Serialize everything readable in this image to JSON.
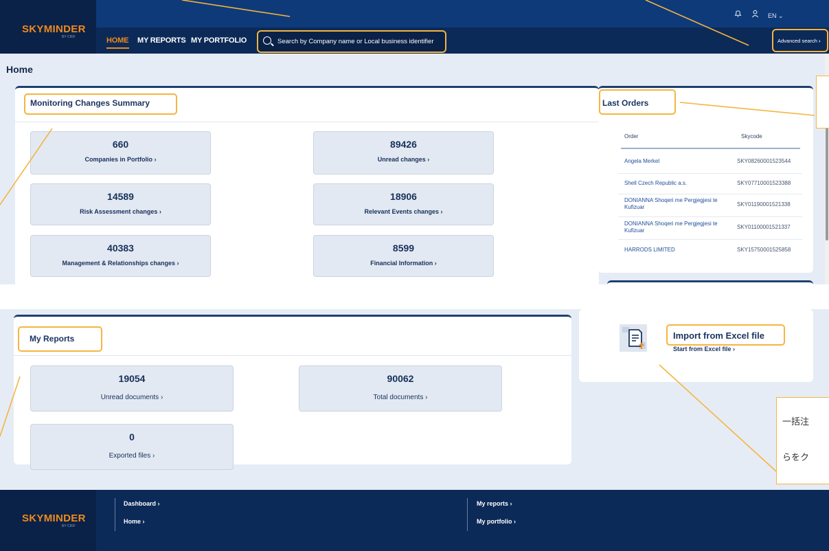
{
  "brand": {
    "name": "SKYMINDER",
    "sub": "BY CRIF"
  },
  "nav": {
    "home": "HOME",
    "reports": "MY REPORTS",
    "portfolio": "MY PORTFOLIO"
  },
  "search": {
    "placeholder": "Search by Company name or Local business identifier"
  },
  "header": {
    "advanced": "Advanced search",
    "lang": "EN"
  },
  "page": {
    "title": "Home"
  },
  "monitoring": {
    "title": "Monitoring Changes Summary",
    "cards": [
      {
        "value": "660",
        "label": "Companies in Portfolio"
      },
      {
        "value": "89426",
        "label": "Unread changes"
      },
      {
        "value": "14589",
        "label": "Risk Assessment changes"
      },
      {
        "value": "18906",
        "label": "Relevant Events changes"
      },
      {
        "value": "40383",
        "label": "Management & Relationships changes"
      },
      {
        "value": "8599",
        "label": "Financial Information"
      }
    ]
  },
  "last_orders": {
    "title": "Last Orders",
    "col_order": "Order",
    "col_skycode": "Skycode",
    "rows": [
      {
        "order": "Angela Merkel",
        "skycode": "SKY08260001523544"
      },
      {
        "order": "Shell Czech Republic a.s.",
        "skycode": "SKY07710001523388"
      },
      {
        "order": "DONIANNA Shoqeri me Pergjegjesi te Kufizuar",
        "skycode": "SKY01190001521338"
      },
      {
        "order": "DONIANNA Shoqeri me Pergjegjesi te Kufizuar",
        "skycode": "SKY01100001521337"
      },
      {
        "order": "HARRODS LIMITED",
        "skycode": "SKY15750001525858"
      }
    ]
  },
  "reports": {
    "title": "My Reports",
    "cards": [
      {
        "value": "19054",
        "label": "Unread documents"
      },
      {
        "value": "90062",
        "label": "Total documents"
      },
      {
        "value": "0",
        "label": "Exported files"
      }
    ]
  },
  "import": {
    "title": "Import from Excel file",
    "link": "Start from Excel file"
  },
  "footer": {
    "dashboard": "Dashboard",
    "home": "Home",
    "my_reports": "My reports",
    "my_portfolio": "My portfolio"
  },
  "callouts": {
    "line1": "一括注",
    "line2": "らをク"
  },
  "colors": {
    "navy": "#0c2a57",
    "orange": "#f08a1c",
    "highlight": "#f5b53f",
    "panel_bg": "#e6ecf5"
  }
}
